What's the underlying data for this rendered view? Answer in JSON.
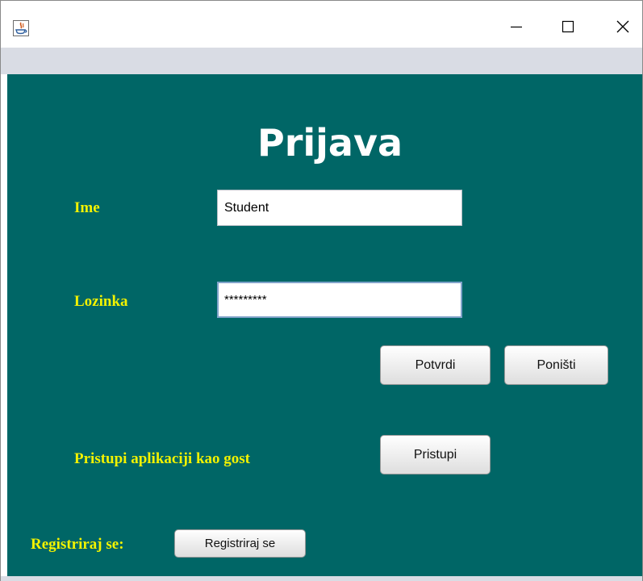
{
  "window": {
    "icon": "java-icon",
    "controls": {
      "minimize": "minimize-icon",
      "maximize": "maximize-icon",
      "close": "close-icon"
    }
  },
  "form": {
    "title": "Prijava",
    "username_label": "Ime",
    "username_value": "Student",
    "password_label": "Lozinka",
    "password_value": "*********",
    "confirm_button": "Potvrdi",
    "cancel_button": "Poništi",
    "guest_label": "Pristupi aplikaciji kao gost",
    "guest_button": "Pristupi",
    "register_label": "Registriraj se:",
    "register_button": "Registriraj se"
  },
  "colors": {
    "background": "#006666",
    "title_text": "#ffffff",
    "label_text": "#f2f200",
    "menubar": "#d9dce4"
  }
}
